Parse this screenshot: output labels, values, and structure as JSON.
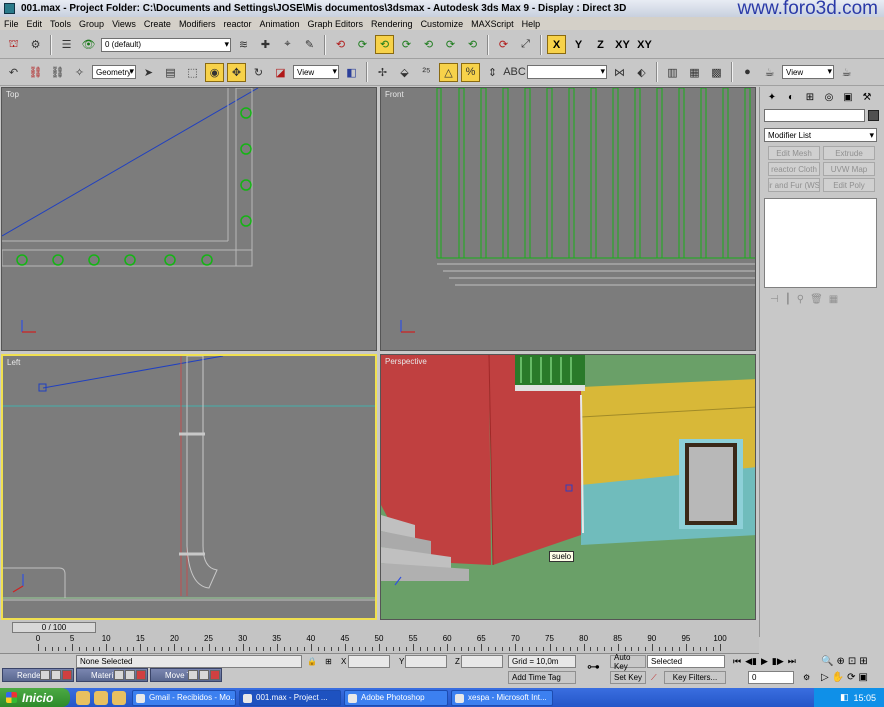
{
  "window": {
    "title": "001.max    - Project Folder: C:\\Documents and Settings\\JOSE\\Mis documentos\\3dsmax      - Autodesk 3ds Max 9       - Display : Direct 3D",
    "watermark": "www.foro3d.com"
  },
  "menu": [
    "File",
    "Edit",
    "Tools",
    "Group",
    "Views",
    "Create",
    "Modifiers",
    "reactor",
    "Animation",
    "Graph Editors",
    "Rendering",
    "Customize",
    "MAXScript",
    "Help"
  ],
  "toolbar1": {
    "layer_dropdown": "0 (default)",
    "axis_buttons": [
      "X",
      "Y",
      "Z",
      "XY",
      "XY"
    ]
  },
  "toolbar2": {
    "selection_filter": "Geometry",
    "coord_system": "View",
    "named_selection": "",
    "render_preset": "View"
  },
  "viewports": {
    "top": "Top",
    "front": "Front",
    "left": "Left",
    "perspective": "Perspective",
    "tooltip": "suelo"
  },
  "command_panel": {
    "modifier_list": "Modifier List",
    "modifier_buttons": [
      "Edit Mesh",
      "Extrude",
      "reactor Cloth",
      "UVW Map",
      "ir and Fur (WS",
      "Edit Poly"
    ]
  },
  "timeline": {
    "slider": "0 / 100",
    "ticks": [
      "0",
      "5",
      "10",
      "15",
      "20",
      "25",
      "30",
      "35",
      "40",
      "45",
      "50",
      "55",
      "60",
      "65",
      "70",
      "75",
      "80",
      "85",
      "90",
      "95",
      "100"
    ]
  },
  "status": {
    "selection": "None Selected",
    "x_label": "X",
    "y_label": "Y",
    "z_label": "Z",
    "grid": "Grid = 10,0m",
    "add_time_tag": "Add Time Tag",
    "auto_key": "Auto Key",
    "set_key": "Set Key",
    "key_mode": "Selected",
    "key_filters": "Key Filters...",
    "frame": "0"
  },
  "floating_windows": [
    "Render...",
    "Materi...",
    "Move T..."
  ],
  "taskbar": {
    "start": "Inicio",
    "items": [
      "Gmail - Recibidos - Mo...",
      "001.max    - Project ...",
      "Adobe Photoshop",
      "xespa - Microsoft Int..."
    ],
    "clock": "15:05"
  }
}
